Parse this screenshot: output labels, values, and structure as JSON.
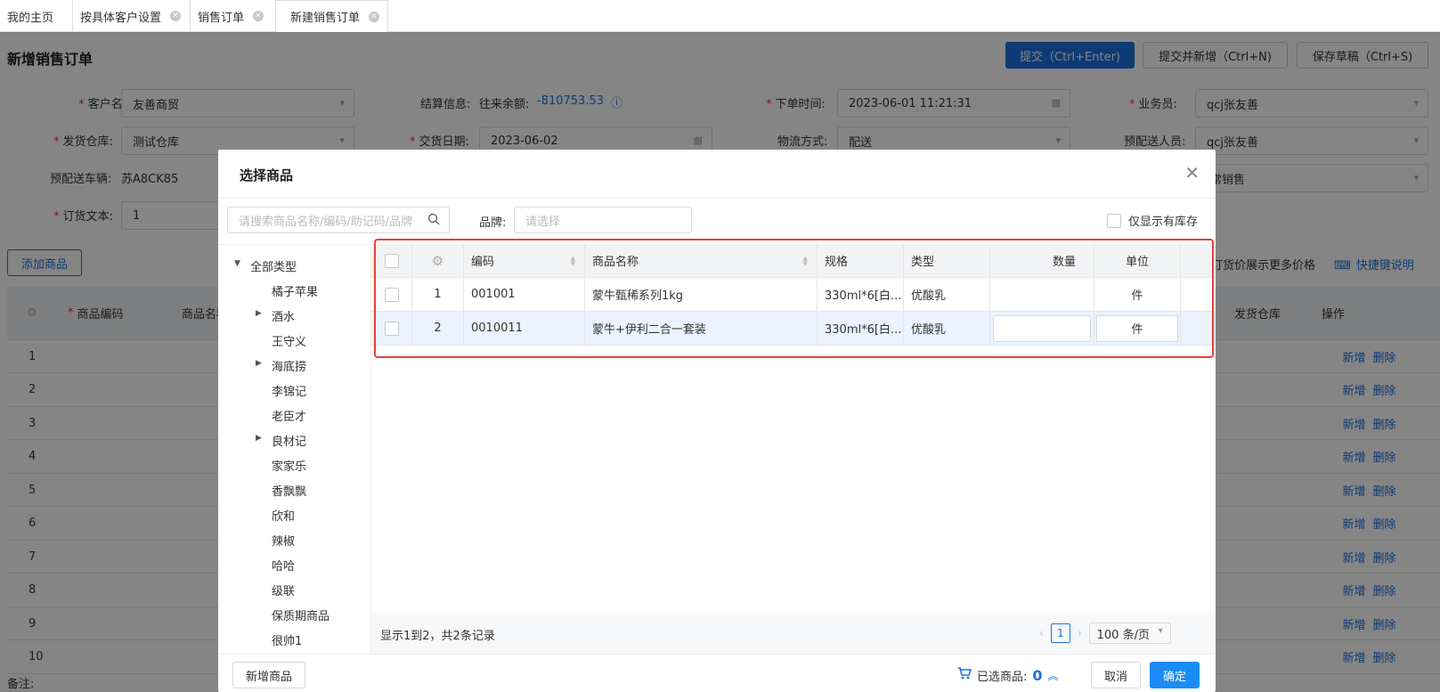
{
  "tabs": [
    {
      "label": "我的主页"
    },
    {
      "label": "按具体客户设置"
    },
    {
      "label": "销售订单"
    },
    {
      "label": "新建销售订单"
    }
  ],
  "page": {
    "title": "新增销售订单",
    "submit": "提交（Ctrl+Enter)",
    "submit_new": "提交并新增（Ctrl+N)",
    "save_draft": "保存草稿（Ctrl+S)"
  },
  "form": {
    "customer_label": "客户名称:",
    "customer": "友善商贸",
    "settle_label": "结算信息:",
    "settle_prefix": "往来余额:",
    "settle_value": "-810753.53",
    "order_time_label": "下单时间:",
    "order_time": "2023-06-01 11:21:31",
    "salesman_label": "业务员:",
    "salesman": "qcj张友善",
    "warehouse_label": "发货仓库:",
    "warehouse": "测试仓库",
    "delivery_date_label": "交货日期:",
    "delivery_date": "2023-06-02",
    "logistics_label": "物流方式:",
    "logistics": "配送",
    "deliver_person_label": "预配送人员:",
    "deliver_person": "qcj张友善",
    "vehicle_label": "预配送车辆:",
    "vehicle": "苏A8CK85",
    "sale_type": "常销售",
    "order_text_label": "订货文本:",
    "order_text": "1"
  },
  "toolbar": {
    "add_goods": "添加商品",
    "more_price": "订货价展示更多价格",
    "shortcut": "快捷键说明"
  },
  "bg_table": {
    "col_code": "商品编码",
    "col_name": "商品名称",
    "col_wh": "发货仓库",
    "col_op": "操作",
    "rows": [
      "1",
      "2",
      "3",
      "4",
      "5",
      "6",
      "7",
      "8",
      "9",
      "10"
    ],
    "op_add": "新增",
    "op_del": "删除"
  },
  "remark_label": "备注:",
  "modal": {
    "title": "选择商品",
    "search_placeholder": "请搜索商品名称/编码/助记码/品牌",
    "brand_label": "品牌:",
    "brand_placeholder": "请选择",
    "stock_only": "仅显示有库存",
    "tree": [
      "全部类型",
      "橘子苹果",
      "酒水",
      "王守义",
      "海底捞",
      "李锦记",
      "老臣才",
      "良材记",
      "家家乐",
      "香飘飘",
      "欣和",
      "辣椒",
      "哈哈",
      "级联",
      "保质期商品",
      "很帅1"
    ],
    "columns": {
      "code": "编码",
      "name": "商品名称",
      "spec": "规格",
      "type": "类型",
      "qty": "数量",
      "unit": "单位"
    },
    "rows": [
      {
        "idx": "1",
        "code": "001001",
        "name": "蒙牛甄稀系列1kg",
        "spec": "330ml*6[白...",
        "type": "优酸乳",
        "unit": "件"
      },
      {
        "idx": "2",
        "code": "0010011",
        "name": "蒙牛+伊利二合一套装",
        "spec": "330ml*6[白...",
        "type": "优酸乳",
        "unit": "件"
      }
    ],
    "total_text": "显示1到2，共2条记录",
    "current_page": "1",
    "page_size": "100 条/页",
    "new_goods": "新增商品",
    "selected_label": "已选商品:",
    "selected_count": "0",
    "cancel": "取消",
    "confirm": "确定"
  }
}
